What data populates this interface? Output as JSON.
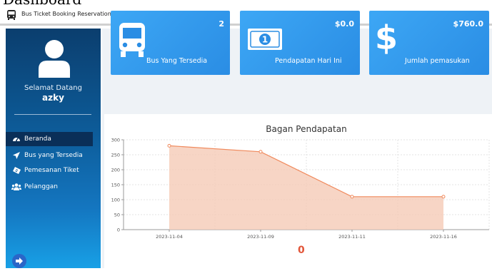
{
  "page_heading": "Dashboard",
  "window": {
    "title": "Bus Ticket Booking Reservation Sustem",
    "minimize_label": "−",
    "close_label": "×"
  },
  "sidebar": {
    "welcome": "Selamat Datang",
    "username": "azky",
    "items": [
      {
        "label": "Beranda",
        "icon": "dashboard-icon",
        "active": true
      },
      {
        "label": "Bus yang Tersedia",
        "icon": "paper-plane-icon",
        "active": false
      },
      {
        "label": "Pemesanan Tiket",
        "icon": "ticket-icon",
        "active": false
      },
      {
        "label": "Pelanggan",
        "icon": "users-icon",
        "active": false
      }
    ],
    "logout_icon": "sign-out-icon"
  },
  "cards": [
    {
      "value": "2",
      "label": "Bus Yang Tersedia",
      "icon": "bus-icon"
    },
    {
      "value": "$0.0",
      "label": "Pendapatan Hari Ini",
      "icon": "money-icon"
    },
    {
      "value": "$760.0",
      "label": "Jumlah pemasukan",
      "icon": "dollar-icon"
    }
  ],
  "chart_data": {
    "type": "area",
    "title": "Bagan Pendapatan",
    "xlabel": "",
    "ylabel": "",
    "categories": [
      "2023-11-04",
      "2023-11-09",
      "2023-11-11",
      "2023-11-16"
    ],
    "values": [
      280,
      260,
      110,
      110
    ],
    "ylim": [
      0,
      300
    ],
    "yticks": [
      0,
      50,
      100,
      150,
      200,
      250,
      300
    ],
    "grid": true,
    "line_color": "#f08a5d",
    "fill_color": "#f5cbb7"
  },
  "footer_value": "0",
  "colors": {
    "card_blue": "#2a8de4",
    "sidebar_dark": "#0b3e6e",
    "sidebar_light": "#18a0e6",
    "accent_orange": "#e2563a"
  }
}
